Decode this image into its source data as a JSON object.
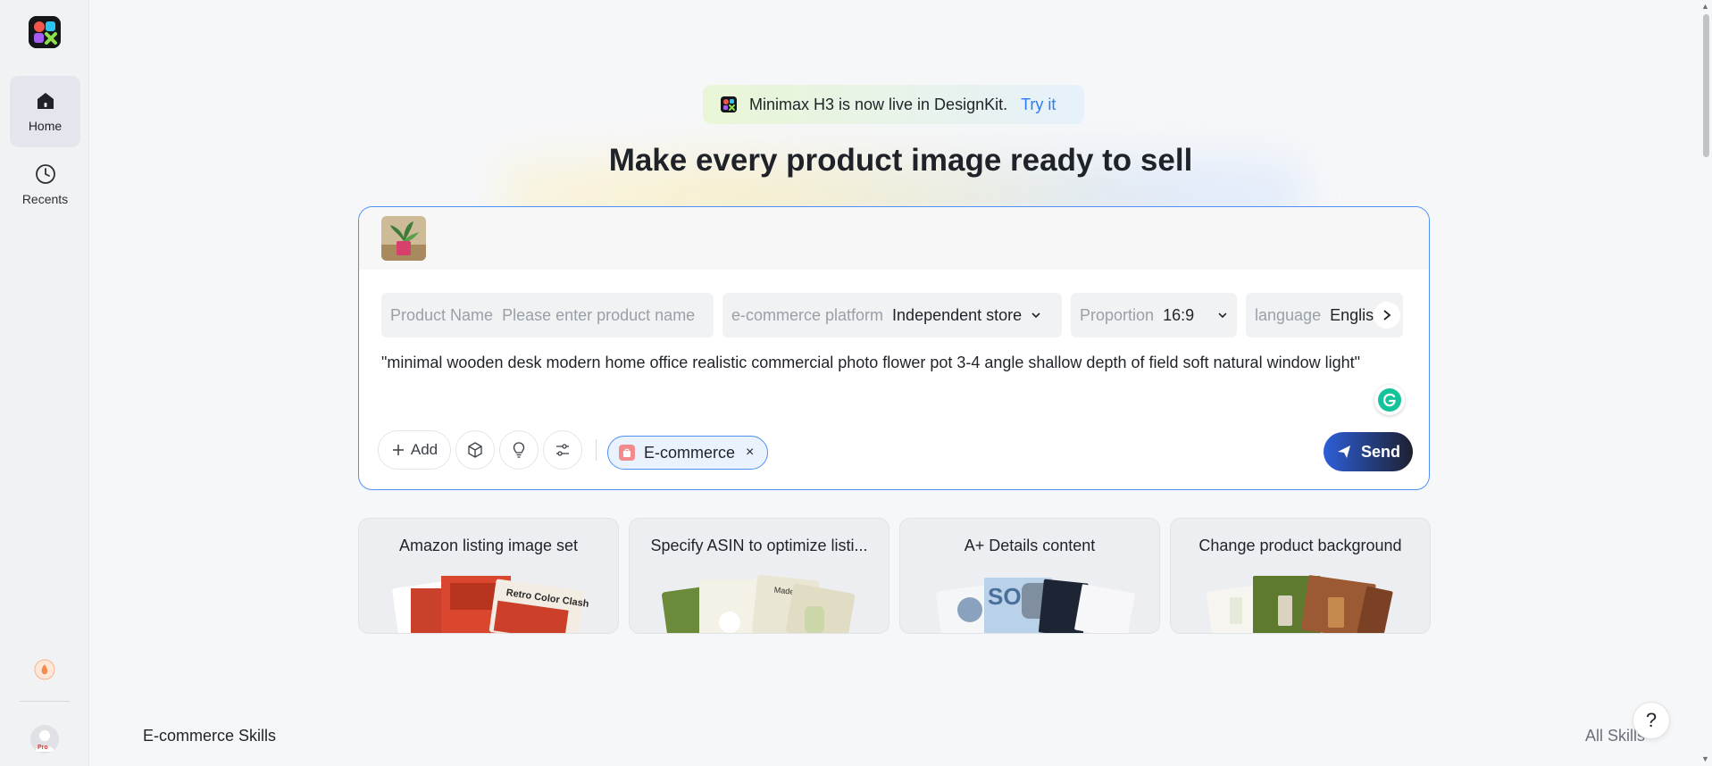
{
  "sidebar": {
    "items": [
      {
        "label": "Home",
        "icon": "home-icon",
        "active": true
      },
      {
        "label": "Recents",
        "icon": "clock-icon",
        "active": false
      }
    ],
    "pro_badge": "Pro"
  },
  "banner": {
    "text": "Minimax H3 is now live in DesignKit.",
    "link": "Try it"
  },
  "headline": "Make every product image ready to sell",
  "composer": {
    "fields": {
      "product_name": {
        "label": "Product Name",
        "placeholder": "Please enter product name"
      },
      "platform": {
        "label": "e-commerce platform",
        "value": "Independent store"
      },
      "proportion": {
        "label": "Proportion",
        "value": "16:9"
      },
      "language": {
        "label": "language",
        "value": "Englis"
      }
    },
    "prompt": "\"minimal wooden desk modern home office realistic commercial photo flower pot 3-4 angle shallow depth of field soft natural window light\"",
    "add_label": "Add",
    "chip_label": "E-commerce",
    "chip_close": "×",
    "send_label": "Send"
  },
  "cards": [
    {
      "title": "Amazon listing image set",
      "overlay": "Retro Color Clash"
    },
    {
      "title": "Specify ASIN to optimize listi...",
      "overlay": "Made for wagging tails"
    },
    {
      "title": "A+ Details content",
      "overlay": "SO"
    },
    {
      "title": "Change product background",
      "overlay": ""
    }
  ],
  "section": {
    "title": "E-commerce Skills",
    "all_link": "All Skills"
  },
  "help_label": "?"
}
